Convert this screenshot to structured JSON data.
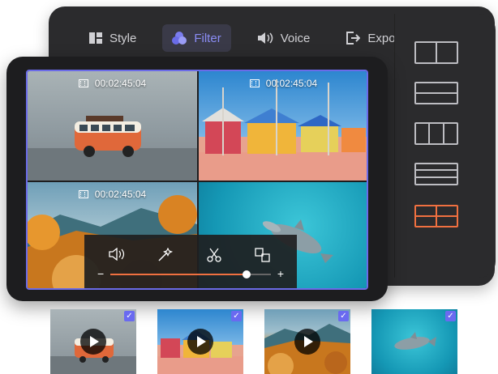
{
  "toolbar": {
    "items": [
      {
        "label": "Style",
        "icon": "style-grid-icon",
        "active": false
      },
      {
        "label": "Filter",
        "icon": "filter-circles-icon",
        "active": true
      },
      {
        "label": "Voice",
        "icon": "speaker-icon",
        "active": false
      },
      {
        "label": "Export",
        "icon": "export-icon",
        "active": false
      }
    ]
  },
  "layouts": {
    "options": [
      "two-columns",
      "two-rows",
      "three-columns",
      "three-rows",
      "two-by-two"
    ],
    "selected": "two-by-two"
  },
  "preview": {
    "cells": [
      {
        "scene": "toy-van",
        "timecode": "00:02:45:04"
      },
      {
        "scene": "beach-huts",
        "timecode": "00:02:45:04"
      },
      {
        "scene": "autumn-mountains",
        "timecode": "00:02:45:04"
      },
      {
        "scene": "dolphin",
        "timecode": ""
      }
    ]
  },
  "controls": {
    "icons": [
      "volume-icon",
      "magic-wand-icon",
      "scissors-icon",
      "swap-icon"
    ],
    "minus": "−",
    "plus": "+",
    "progress": 0.85
  },
  "thumbnails": [
    {
      "scene": "toy-van",
      "checked": true,
      "play": true
    },
    {
      "scene": "beach-huts",
      "checked": true,
      "play": true
    },
    {
      "scene": "autumn-mountains",
      "checked": true,
      "play": true
    },
    {
      "scene": "dolphin",
      "checked": true,
      "play": false
    }
  ],
  "colors": {
    "accent": "#6b6be8",
    "active_layout": "#f07040",
    "slider_fill": "#f07040"
  }
}
